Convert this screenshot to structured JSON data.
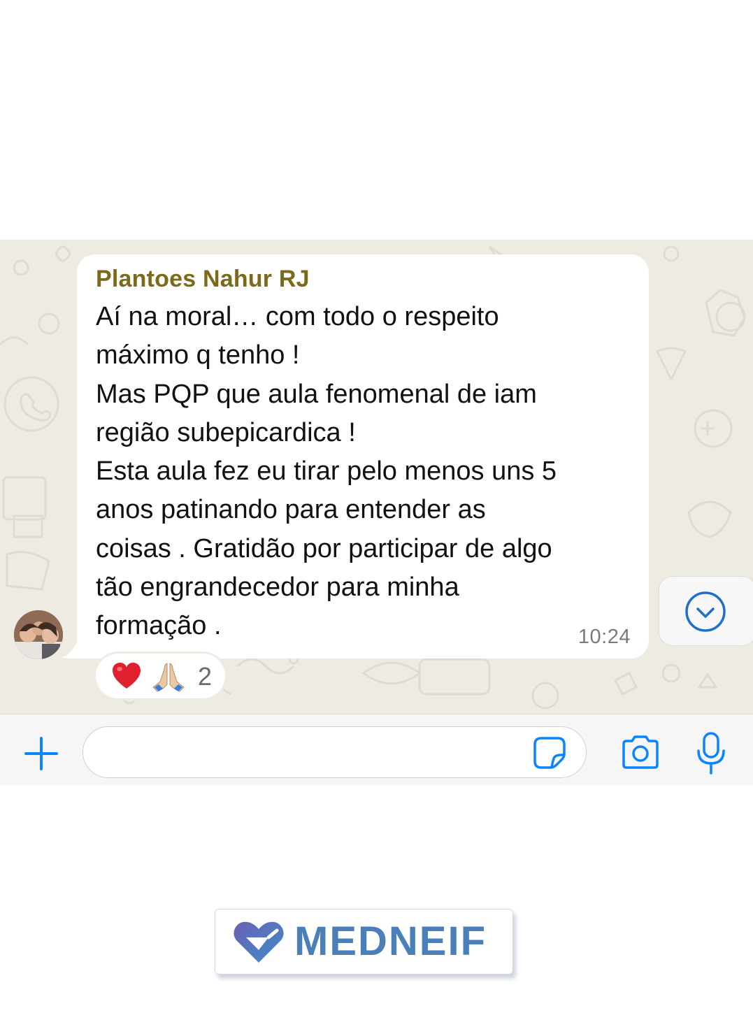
{
  "message": {
    "sender": "Plantoes Nahur RJ",
    "text": "Aí na moral… com todo o respeito\nmáximo q tenho !\nMas PQP que aula fenomenal de iam\nregião subepicardica !\nEsta aula fez eu tirar pelo menos uns 5\nanos patinando para entender as\ncoisas . Gratidão por participar de algo\ntão engrandecedor para minha\nformação .",
    "time": "10:24",
    "reactions": {
      "emojis": [
        "red-heart",
        "folded-hands"
      ],
      "count": "2"
    }
  },
  "input": {
    "placeholder": ""
  },
  "icons": {
    "scroll_down": "chevron-down-circle-icon",
    "attach": "plus-icon",
    "sticker": "sticker-icon",
    "camera": "camera-icon",
    "mic": "microphone-icon"
  },
  "colors": {
    "accent": "#0a84ff",
    "sender_name": "#7c6a1b",
    "chat_background": "#eeebe3",
    "logo_text": "#4a7fb9"
  },
  "brand": {
    "name": "MEDNEIF"
  }
}
